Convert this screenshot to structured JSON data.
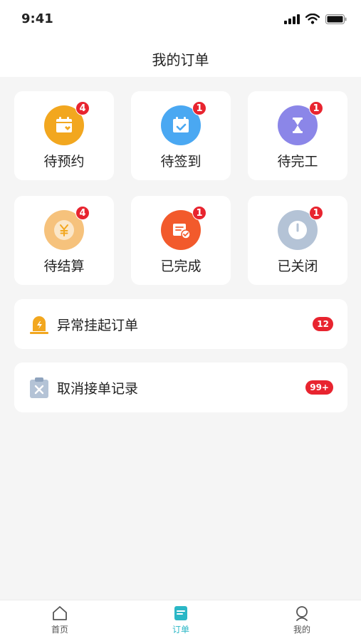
{
  "status_bar": {
    "time": "9:41",
    "icons": [
      "signal-icon",
      "wifi-icon",
      "battery-icon"
    ]
  },
  "header": {
    "title": "我的订单"
  },
  "order_categories": [
    {
      "label": "待预约",
      "badge": "4",
      "icon": "calendar-heart-icon",
      "color": "#f2a71f"
    },
    {
      "label": "待签到",
      "badge": "1",
      "icon": "calendar-check-icon",
      "color": "#4aa8f2"
    },
    {
      "label": "待完工",
      "badge": "1",
      "icon": "hourglass-icon",
      "color": "#8b86e8"
    },
    {
      "label": "待结算",
      "badge": "4",
      "icon": "yuan-icon",
      "color": "#f6c27c"
    },
    {
      "label": "已完成",
      "badge": "1",
      "icon": "receipt-check-icon",
      "color": "#f25a2c"
    },
    {
      "label": "已关闭",
      "badge": "1",
      "icon": "power-icon",
      "color": "#b4c3d6"
    }
  ],
  "list_rows": [
    {
      "label": "异常挂起订单",
      "badge": "12",
      "icon": "alarm-icon"
    },
    {
      "label": "取消接单记录",
      "badge": "99+",
      "icon": "cancel-clipboard-icon"
    }
  ],
  "tabbar": {
    "items": [
      {
        "label": "首页",
        "icon": "home-icon",
        "active": false
      },
      {
        "label": "订单",
        "icon": "order-icon",
        "active": true
      },
      {
        "label": "我的",
        "icon": "profile-icon",
        "active": false
      }
    ],
    "accent": "#2bb7c6"
  }
}
